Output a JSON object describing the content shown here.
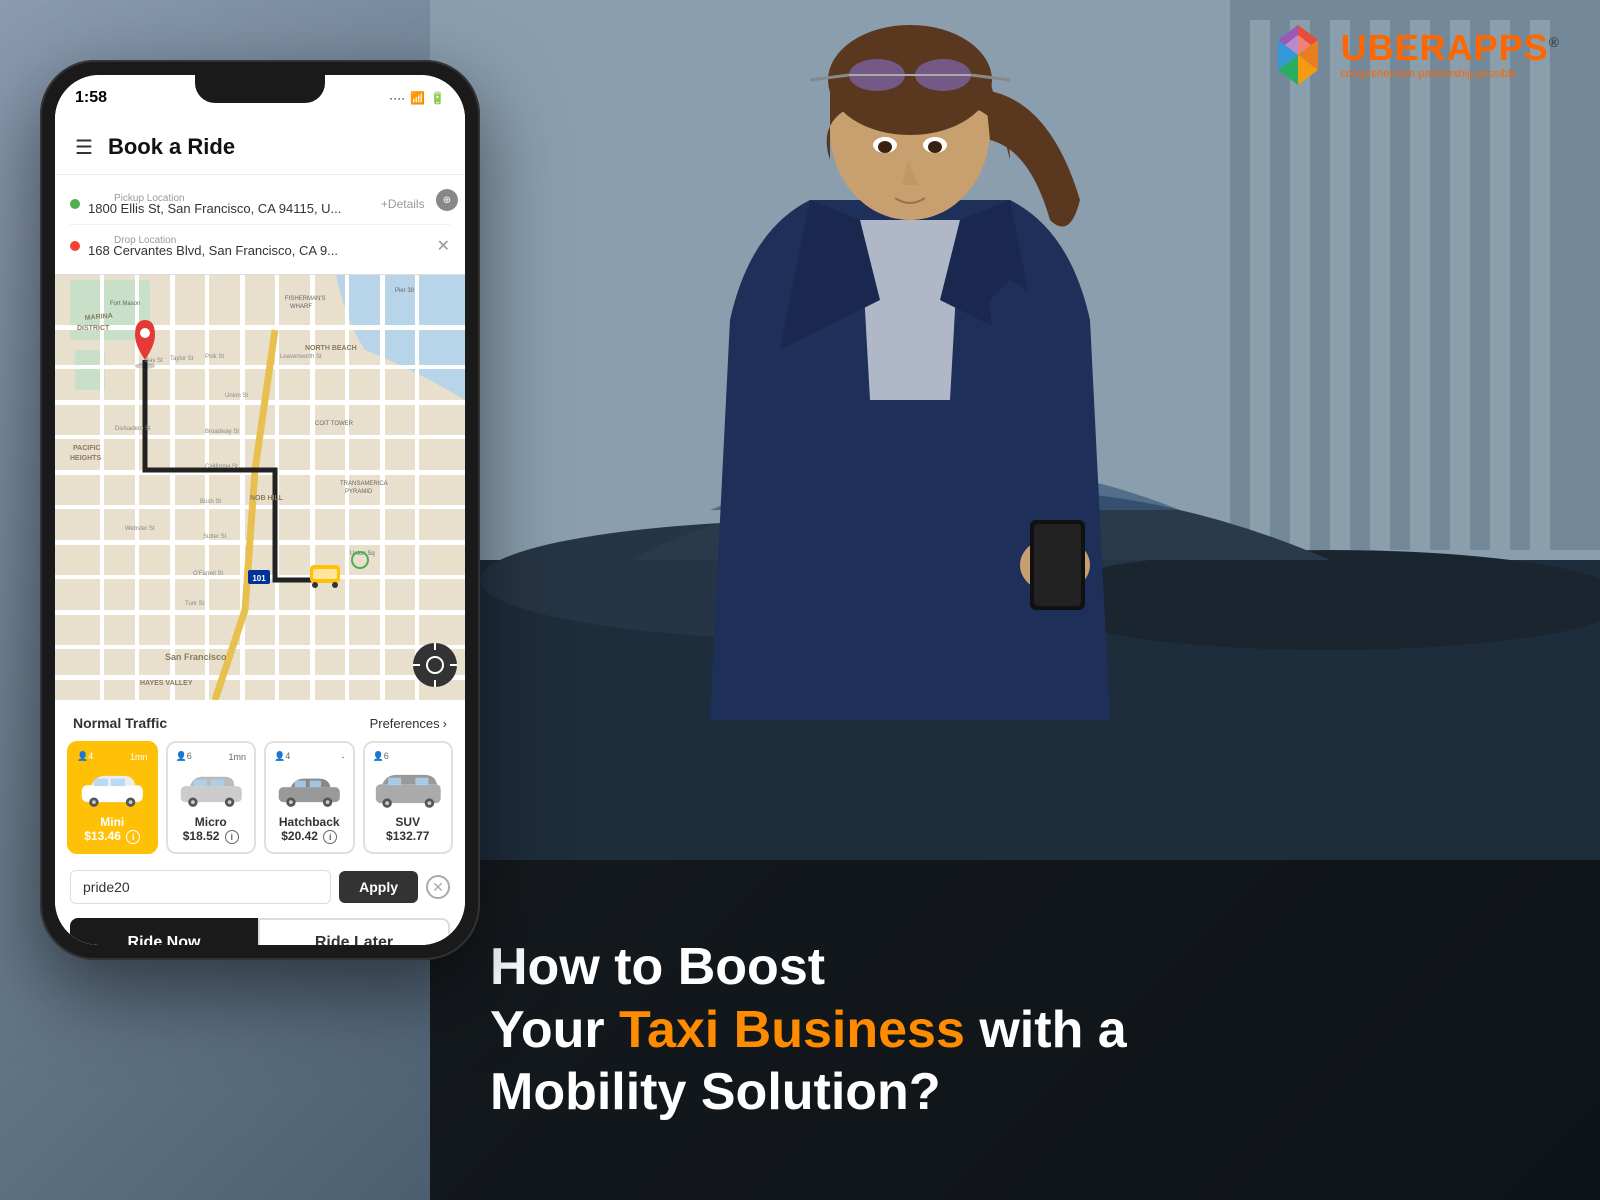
{
  "logo": {
    "brand": "UBER",
    "brand_suffix": "APPS",
    "registered": "®",
    "tagline": "comprehensive partnership possible"
  },
  "phone": {
    "status_time": "1:58",
    "header_title": "Book a Ride",
    "pickup_label": "Pickup Location",
    "pickup_value": "1800 Ellis St, San Francisco, CA 94115, U...",
    "drop_label": "Drop Location",
    "drop_value": "168 Cervantes Blvd, San Francisco, CA 9...",
    "details_btn": "+Details",
    "traffic_label": "Normal Traffic",
    "preferences_label": "Preferences",
    "car_options": [
      {
        "name": "Mini",
        "price": "$13.46",
        "passengers": "4",
        "time": "1mn",
        "selected": true
      },
      {
        "name": "Micro",
        "price": "$18.52",
        "passengers": "6",
        "time": "1mn",
        "selected": false
      },
      {
        "name": "Hatchback",
        "price": "$20.42",
        "passengers": "4",
        "time": "-",
        "selected": false
      },
      {
        "name": "SUV",
        "price": "$132.77",
        "passengers": "6",
        "time": "",
        "selected": false
      }
    ],
    "promo_code": "pride20",
    "apply_label": "Apply",
    "ride_now_label": "Ride Now",
    "ride_later_label": "Ride Later"
  },
  "headline": {
    "line1": "How to Boost",
    "line2_part1": "Your ",
    "line2_accent": "Taxi Business",
    "line2_part2": " with a",
    "line3": "Mobility Solution?"
  },
  "map": {
    "city": "San Francisco",
    "districts": [
      "MARINA DISTRICT",
      "PACIFIC HEIGHTS",
      "NOB HILL",
      "NORTH BEACH",
      "HAYES VALLEY"
    ],
    "landmarks": [
      "Fort Mason",
      "FISHERMAN'S WHARF",
      "COIT TOWER",
      "TRANSAMERICA PYRAMID",
      "Union Sq"
    ]
  }
}
